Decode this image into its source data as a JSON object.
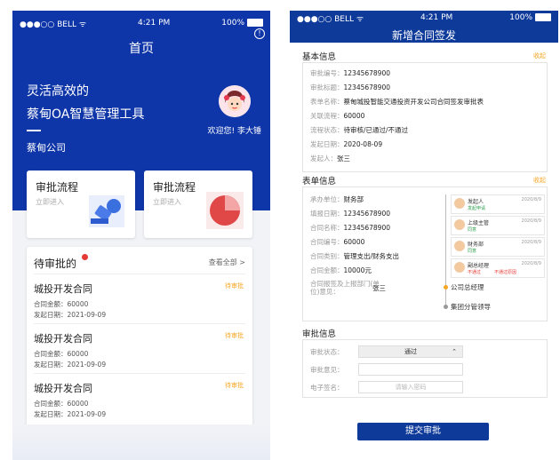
{
  "left": {
    "status": {
      "carrier": "●●●○○ BELL ᯤ",
      "time": "4:21 PM",
      "battery": "100%"
    },
    "title": "首页",
    "slogan_line1": "灵活高效的",
    "slogan_line2": "蔡甸OA智慧管理工具",
    "company": "蔡甸公司",
    "welcome": "欢迎您! 李大锤",
    "cards": [
      {
        "title": "审批流程",
        "subtitle": "立即进入"
      },
      {
        "title": "审批流程",
        "subtitle": "立即进入"
      }
    ],
    "pending": {
      "title": "待审批的",
      "view_all": "查看全部 >",
      "items": [
        {
          "title": "城投开发合同",
          "status": "待审批",
          "amount": "合同金额：60000",
          "date": "发起日期：2021-09-09"
        },
        {
          "title": "城投开发合同",
          "status": "待审批",
          "amount": "合同金额：60000",
          "date": "发起日期：2021-09-09"
        },
        {
          "title": "城投开发合同",
          "status": "待审批",
          "amount": "合同金额：60000",
          "date": "发起日期：2021-09-09"
        }
      ]
    }
  },
  "right": {
    "status": {
      "carrier": "●●●○○ BELL ᯤ",
      "time": "4:21 PM",
      "battery": "100%"
    },
    "title": "新增合同签发",
    "basic": {
      "heading": "基本信息",
      "collapse": "收起",
      "rows": [
        {
          "k": "审批编号：",
          "v": "12345678900"
        },
        {
          "k": "审批标题：",
          "v": "12345678900"
        },
        {
          "k": "表单名称：",
          "v": "蔡甸城投智能交通投资开发公司合同签发审批表"
        },
        {
          "k": "关联流程：",
          "v": "60000"
        },
        {
          "k": "流程状态：",
          "v": "待审核/已通过/不通过"
        },
        {
          "k": "发起日期：",
          "v": "2020-08-09"
        },
        {
          "k": "发起人：",
          "v": "张三"
        }
      ]
    },
    "form": {
      "heading": "表单信息",
      "collapse": "收起",
      "rows": [
        {
          "k": "承办单位：",
          "v": "财务部"
        },
        {
          "k": "填报日期：",
          "v": "12345678900"
        },
        {
          "k": "合同名称：",
          "v": "12345678900"
        },
        {
          "k": "合同编号：",
          "v": "60000"
        },
        {
          "k": "合同类别：",
          "v": "管理支出/财务支出"
        },
        {
          "k": "合同金额：",
          "v": "10000元"
        }
      ],
      "extra_key": "合同报签及上报部门(单位)意见：",
      "extra_val": "张三",
      "timeline": [
        {
          "name": "发起人",
          "status": "发起申请",
          "date": "2020/8/9",
          "color": "#2e9e4f"
        },
        {
          "name": "上级主管",
          "status": "同意",
          "date": "2020/8/9",
          "color": "#2e9e4f"
        },
        {
          "name": "财务部",
          "status": "同意",
          "date": "2020/8/9",
          "color": "#2e9e4f"
        },
        {
          "name": "副总经理",
          "status": "不通过",
          "note": "不通过原因",
          "date": "2020/8/9",
          "color": "#e53935"
        }
      ],
      "next1": "公司总经理",
      "next2": "集团分管领导"
    },
    "approval": {
      "heading": "审批信息",
      "status_label": "审批状态：",
      "status_value": "通过",
      "opinion_label": "审批意见：",
      "opinion_value": "",
      "sign_label": "电子签名：",
      "sign_placeholder": "请输入密码"
    },
    "submit": "提交审批"
  }
}
